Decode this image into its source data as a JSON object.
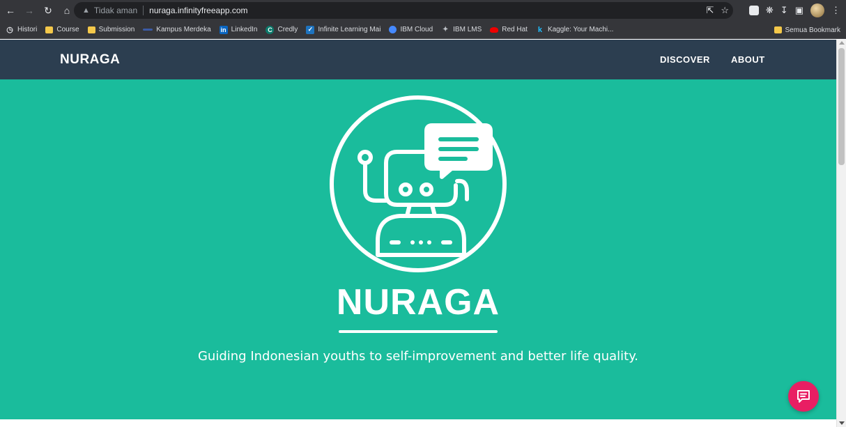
{
  "browser": {
    "omnibox": {
      "security_label": "Tidak aman",
      "url": "nuraga.infinityfreeapp.com"
    },
    "bookmarks": [
      {
        "label": "Histori",
        "icon": "history-icon"
      },
      {
        "label": "Course",
        "icon": "folder-icon"
      },
      {
        "label": "Submission",
        "icon": "folder-icon"
      },
      {
        "label": "Kampus Merdeka",
        "icon": "kampus-merdeka-icon"
      },
      {
        "label": "LinkedIn",
        "icon": "linkedin-icon"
      },
      {
        "label": "Credly",
        "icon": "credly-icon"
      },
      {
        "label": "Infinite Learning Mai",
        "icon": "infinite-learning-icon"
      },
      {
        "label": "IBM Cloud",
        "icon": "ibm-cloud-icon"
      },
      {
        "label": "IBM LMS",
        "icon": "ibm-lms-icon"
      },
      {
        "label": "Red Hat",
        "icon": "redhat-icon"
      },
      {
        "label": "Kaggle: Your Machi...",
        "icon": "kaggle-icon"
      }
    ],
    "all_bookmarks": "Semua Bookmark"
  },
  "site": {
    "brand": "NURAGA",
    "nav": {
      "discover": "DISCOVER",
      "about": "ABOUT"
    },
    "hero": {
      "title": "NURAGA",
      "subtitle": "Guiding Indonesian youths to self-improvement and better life quality."
    }
  },
  "colors": {
    "navbar": "#2c3e50",
    "hero": "#1abc9c",
    "fab": "#e91e63",
    "chrome": "#35363a"
  }
}
